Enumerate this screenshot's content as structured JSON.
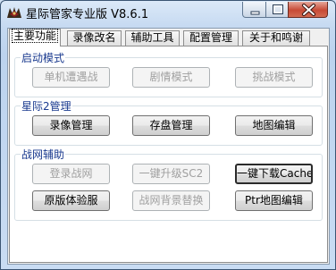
{
  "window": {
    "title": "星际管家专业版 V8.6.1",
    "controls": {
      "minimize": "minimize",
      "maximize": "maximize",
      "close": "close"
    }
  },
  "tabs": [
    {
      "label": "主要功能",
      "active": true
    },
    {
      "label": "录像改名",
      "active": false
    },
    {
      "label": "辅助工具",
      "active": false
    },
    {
      "label": "配置管理",
      "active": false
    },
    {
      "label": "关于和鸣谢",
      "active": false
    }
  ],
  "groups": {
    "launch": {
      "label": "启动模式",
      "buttons": [
        {
          "label": "单机遭遇战",
          "enabled": false
        },
        {
          "label": "剧情模式",
          "enabled": false
        },
        {
          "label": "挑战模式",
          "enabled": false
        }
      ]
    },
    "sc2": {
      "label": "星际2管理",
      "buttons": [
        {
          "label": "录像管理",
          "enabled": true
        },
        {
          "label": "存盘管理",
          "enabled": true
        },
        {
          "label": "地图编辑",
          "enabled": true
        }
      ]
    },
    "battlenet": {
      "label": "战网辅助",
      "buttons": [
        {
          "label": "登录战网",
          "enabled": false
        },
        {
          "label": "一键升级SC2",
          "enabled": false
        },
        {
          "label": "一键下载Cache",
          "enabled": true
        },
        {
          "label": "原版体验服",
          "enabled": true
        },
        {
          "label": "战网背景替换",
          "enabled": false
        },
        {
          "label": "Ptr地图编辑",
          "enabled": true
        }
      ]
    }
  }
}
